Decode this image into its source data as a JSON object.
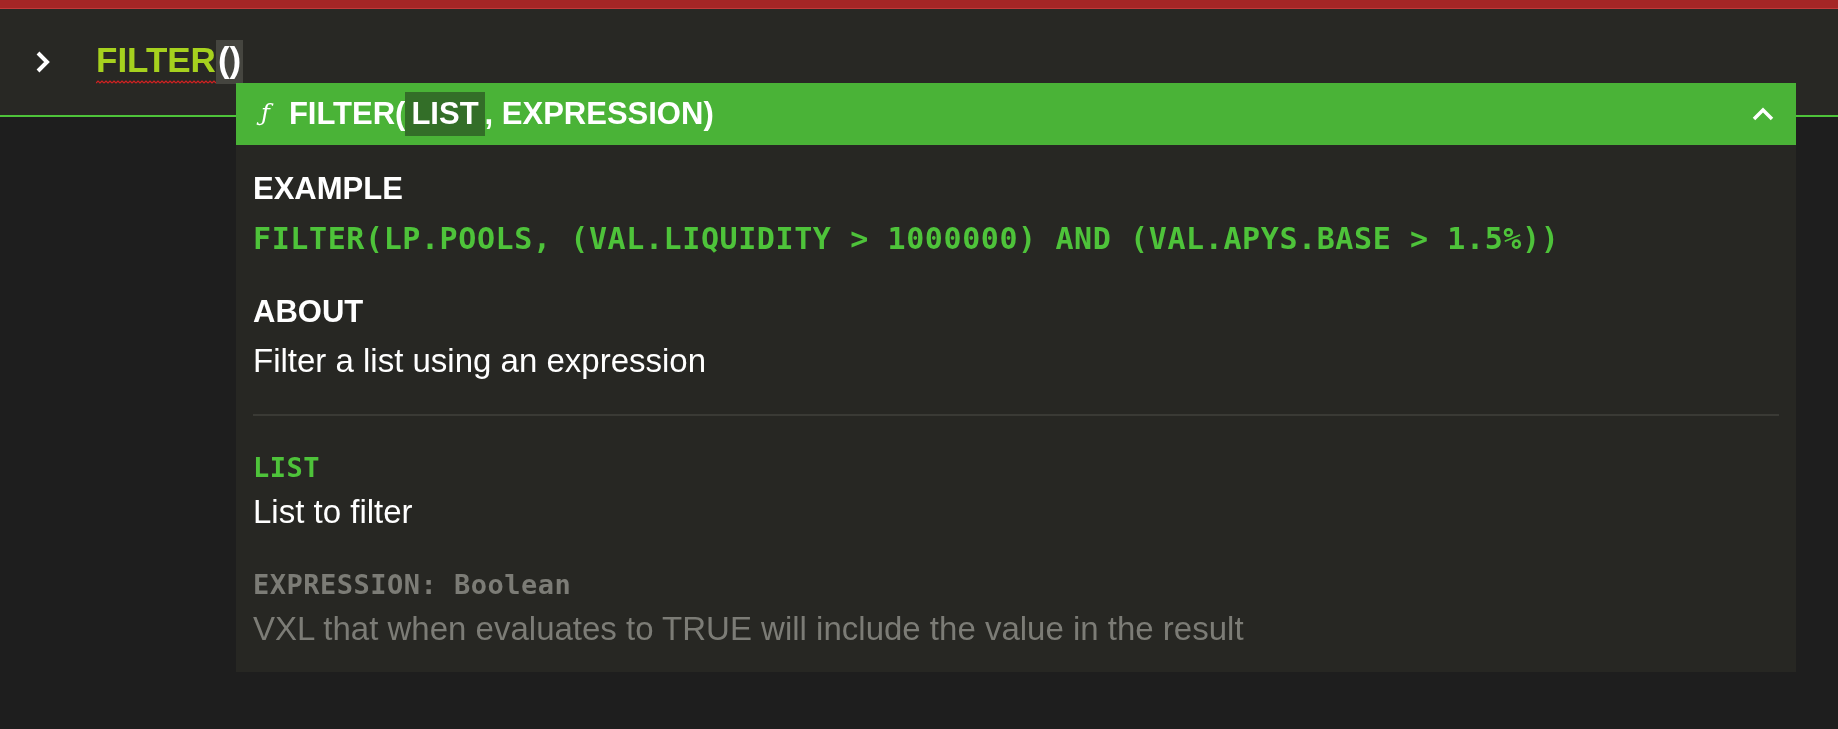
{
  "editor": {
    "function": "FILTER",
    "brackets": "()",
    "error": true,
    "bracket_highlight": true
  },
  "popup": {
    "expanded": true,
    "icon": "ƒ",
    "signature": {
      "prefix": "FILTER(",
      "separator": ", ",
      "suffix": ")",
      "params": [
        {
          "label": "LIST",
          "selected": true
        },
        {
          "label": "EXPRESSION",
          "selected": false
        }
      ]
    },
    "sections": [
      {
        "heading": "EXAMPLE",
        "kind": "code",
        "text": "FILTER(LP.POOLS, (VAL.LIQUIDITY > 1000000) AND (VAL.APYS.BASE > 1.5%))"
      },
      {
        "heading": "ABOUT",
        "kind": "prose",
        "text": "Filter a list using an expression"
      }
    ],
    "parameters": [
      {
        "label": "LIST",
        "description": "List to filter",
        "selected": true
      },
      {
        "label": "EXPRESSION: Boolean",
        "description": "VXL that when evaluates to TRUE will include the value in the result",
        "selected": false
      }
    ]
  }
}
